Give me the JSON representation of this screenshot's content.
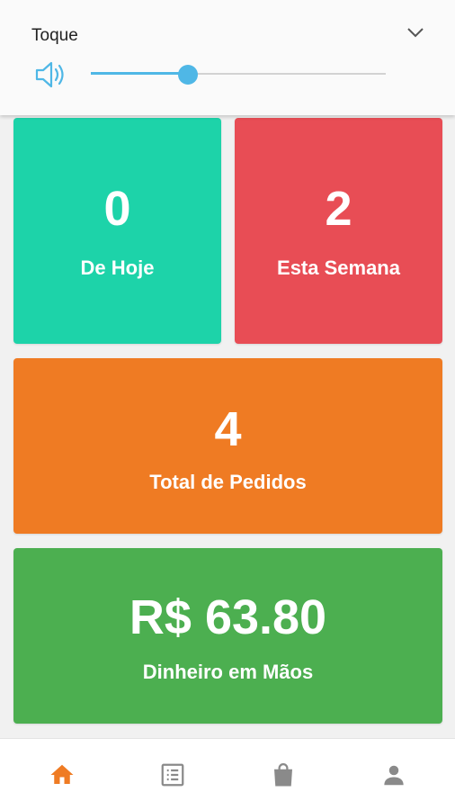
{
  "volume": {
    "title": "Toque",
    "level": 0.33,
    "icons": {
      "speaker": "volume-speaker-icon",
      "collapse": "chevron-down-icon"
    },
    "accent_color": "#4fb7e6"
  },
  "stats": {
    "today": {
      "value": "0",
      "label": "De Hoje",
      "color": "#1dd3a9"
    },
    "week": {
      "value": "2",
      "label": "Esta Semana",
      "color": "#e84d55"
    },
    "total": {
      "value": "4",
      "label": "Total de Pedidos",
      "color": "#ef7b23"
    },
    "money": {
      "value": "R$ 63.80",
      "label": "Dinheiro em Mãos",
      "color": "#4caf50"
    }
  },
  "bottom_nav": {
    "items": [
      {
        "icon": "home-icon",
        "active": true,
        "color": "#ef7b23"
      },
      {
        "icon": "list-icon",
        "active": false,
        "color": "#8a8a8a"
      },
      {
        "icon": "shopping-bag-icon",
        "active": false,
        "color": "#8a8a8a"
      },
      {
        "icon": "person-icon",
        "active": false,
        "color": "#8a8a8a"
      }
    ]
  }
}
